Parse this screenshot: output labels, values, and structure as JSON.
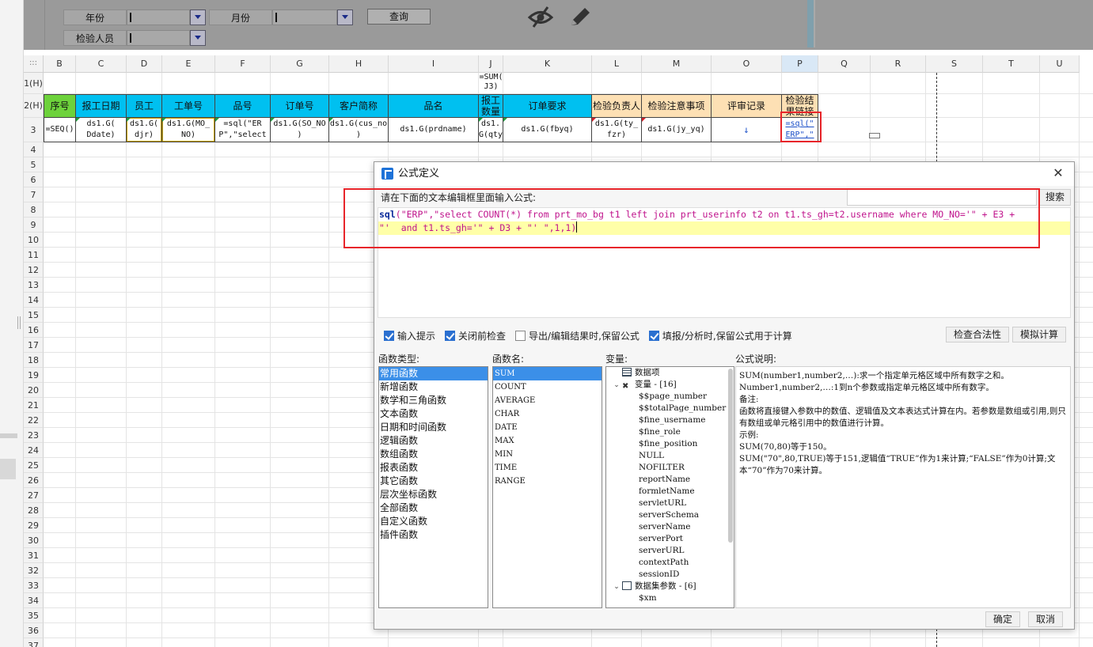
{
  "params": {
    "year_label": "年份",
    "month_label": "月份",
    "inspector_label": "检验人员",
    "query_button": "查询"
  },
  "columns": [
    "B",
    "C",
    "D",
    "E",
    "F",
    "G",
    "H",
    "I",
    "J",
    "K",
    "L",
    "M",
    "O",
    "P",
    "Q",
    "R",
    "S",
    "T",
    "U"
  ],
  "rows": [
    "1(H)",
    "2(H)",
    "3",
    "4",
    "5",
    "6",
    "7",
    "8",
    "9",
    "10",
    "11",
    "12",
    "13",
    "14",
    "15",
    "16",
    "17",
    "18",
    "19",
    "20",
    "21",
    "22",
    "23",
    "24",
    "25",
    "26",
    "27",
    "28",
    "29",
    "30",
    "31",
    "32",
    "33",
    "34",
    "35",
    "36",
    "37"
  ],
  "corner": ":::",
  "row1": {
    "j_formula": "=SUM( J3)"
  },
  "headers": [
    "序号",
    "报工日期",
    "员工",
    "工单号",
    "品号",
    "订单号",
    "客户简称",
    "品名",
    "报工 数量",
    "订单要求",
    "检验负责人",
    "检验注意事项",
    "评审记录",
    "检验结 果链接"
  ],
  "row3": [
    "=SEQ()",
    "ds1.G( Ddate)",
    "ds1.G( djr)",
    "ds1.G(MO_ NO)",
    "=sql(\"ER P\",\"select",
    "ds1.G(SO_NO )",
    "ds1.G(cus_no )",
    "ds1.G(prdname)",
    "ds1. G(qty",
    "ds1.G(fbyq)",
    "ds1.G(ty_ fzr)",
    "ds1.G(jy_yq)",
    "↓",
    "=sql(\" ERP\",\""
  ],
  "dialog": {
    "title": "公式定义",
    "close": "✕",
    "instruction": "请在下面的文本编辑框里面输入公式:",
    "search_button": "搜索",
    "formula_fn": "sql",
    "formula_line1": "(\"ERP\",\"select COUNT(*) from prt_mo_bg t1 left join prt_userinfo t2 on t1.ts_gh=t2.username where MO_NO='\" + E3 +",
    "formula_line2": "\"'  and t1.ts_gh='\" + D3 + \"' \",1,1)",
    "options": [
      {
        "label": "输入提示",
        "checked": true
      },
      {
        "label": "关闭前检查",
        "checked": true
      },
      {
        "label": "导出/编辑结果时,保留公式",
        "checked": false
      },
      {
        "label": "填报/分析时,保留公式用于计算",
        "checked": true
      }
    ],
    "check_button": "检查合法性",
    "simulate_button": "模拟计算",
    "fn_type_label": "函数类型:",
    "fn_name_label": "函数名:",
    "var_label": "变量:",
    "desc_label": "公式说明:",
    "fn_types": [
      "常用函数",
      "新增函数",
      "数学和三角函数",
      "文本函数",
      "日期和时间函数",
      "逻辑函数",
      "数组函数",
      "报表函数",
      "其它函数",
      "层次坐标函数",
      "全部函数",
      "自定义函数",
      "插件函数"
    ],
    "fn_names": [
      "SUM",
      "COUNT",
      "AVERAGE",
      "CHAR",
      "DATE",
      "MAX",
      "MIN",
      "TIME",
      "RANGE"
    ],
    "variables": [
      {
        "text": "数据项",
        "level": 0,
        "icon": "table-icon",
        "toggle": ""
      },
      {
        "text": "变量 - [16]",
        "level": 0,
        "icon": "variable-icon",
        "toggle": "⌄"
      },
      {
        "text": "$$page_number",
        "level": 1
      },
      {
        "text": "$$totalPage_number",
        "level": 1
      },
      {
        "text": "$fine_username",
        "level": 1
      },
      {
        "text": "$fine_role",
        "level": 1
      },
      {
        "text": "$fine_position",
        "level": 1
      },
      {
        "text": "NULL",
        "level": 1
      },
      {
        "text": "NOFILTER",
        "level": 1
      },
      {
        "text": "reportName",
        "level": 1
      },
      {
        "text": "formletName",
        "level": 1
      },
      {
        "text": "servletURL",
        "level": 1
      },
      {
        "text": "serverSchema",
        "level": 1
      },
      {
        "text": "serverName",
        "level": 1
      },
      {
        "text": "serverPort",
        "level": 1
      },
      {
        "text": "serverURL",
        "level": 1
      },
      {
        "text": "contextPath",
        "level": 1
      },
      {
        "text": "sessionID",
        "level": 1
      },
      {
        "text": "数据集参数 - [6]",
        "level": 0,
        "icon": "dataset-icon",
        "toggle": "⌄"
      },
      {
        "text": "$xm",
        "level": 1
      }
    ],
    "desc_lines": [
      "SUM(number1,number2,…):求一个指定单元格区域中所有数字之和。",
      "Number1,number2,…:1到n个参数或指定单元格区域中所有数字。",
      "备注:",
      "函数将直接键入参数中的数值、逻辑值及文本表达式计算在内。若参数是数组或引用,则只有数组或单元格引用中的数值进行计算。",
      "示例:",
      "SUM(70,80)等于150。",
      "SUM(\"70\",80,TRUE)等于151,逻辑值“TRUE”作为1来计算;“FALSE”作为0计算;文本“70”作为70来计算。"
    ],
    "ok_button": "确定",
    "cancel_button": "取消"
  }
}
